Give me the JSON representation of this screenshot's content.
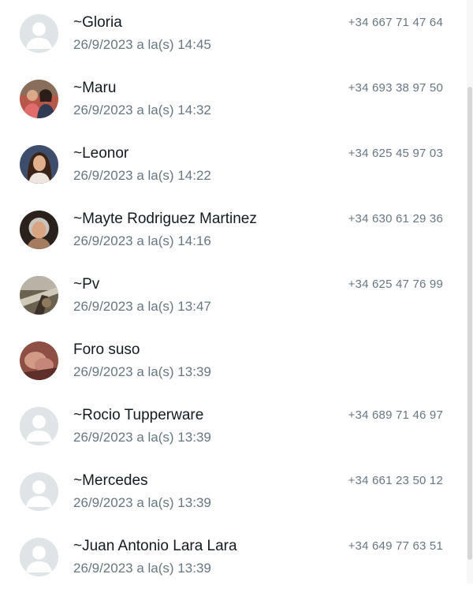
{
  "messages": [
    {
      "name": "~Gloria",
      "date": "26/9/2023 a la(s) 14:45",
      "phone": "+34 667 71 47 64",
      "avatar_icon": "default-avatar-icon"
    },
    {
      "name": "~Maru",
      "date": "26/9/2023 a la(s) 14:32",
      "phone": "+34 693 38 97 50",
      "avatar_icon": "photo-avatar"
    },
    {
      "name": "~Leonor",
      "date": "26/9/2023 a la(s) 14:22",
      "phone": "+34 625 45 97 03",
      "avatar_icon": "photo-avatar"
    },
    {
      "name": "~Mayte Rodriguez Martinez",
      "date": "26/9/2023 a la(s) 14:16",
      "phone": "+34 630 61 29 36",
      "avatar_icon": "photo-avatar"
    },
    {
      "name": "~Pv",
      "date": "26/9/2023 a la(s) 13:47",
      "phone": "+34 625 47 76 99",
      "avatar_icon": "photo-avatar"
    },
    {
      "name": "Foro suso",
      "date": "26/9/2023 a la(s) 13:39",
      "phone": "",
      "avatar_icon": "photo-avatar"
    },
    {
      "name": "~Rocio Tupperware",
      "date": "26/9/2023 a la(s) 13:39",
      "phone": "+34 689 71 46 97",
      "avatar_icon": "default-avatar-icon"
    },
    {
      "name": "~Mercedes",
      "date": "26/9/2023 a la(s) 13:39",
      "phone": "+34 661 23 50 12",
      "avatar_icon": "default-avatar-icon"
    },
    {
      "name": "~Juan Antonio Lara Lara",
      "date": "26/9/2023 a la(s) 13:39",
      "phone": "+34 649 77 63 51",
      "avatar_icon": "default-avatar-icon"
    }
  ],
  "colors": {
    "name": "#111b21",
    "secondary": "#667781",
    "default_avatar_bg": "#dfe5e7"
  }
}
